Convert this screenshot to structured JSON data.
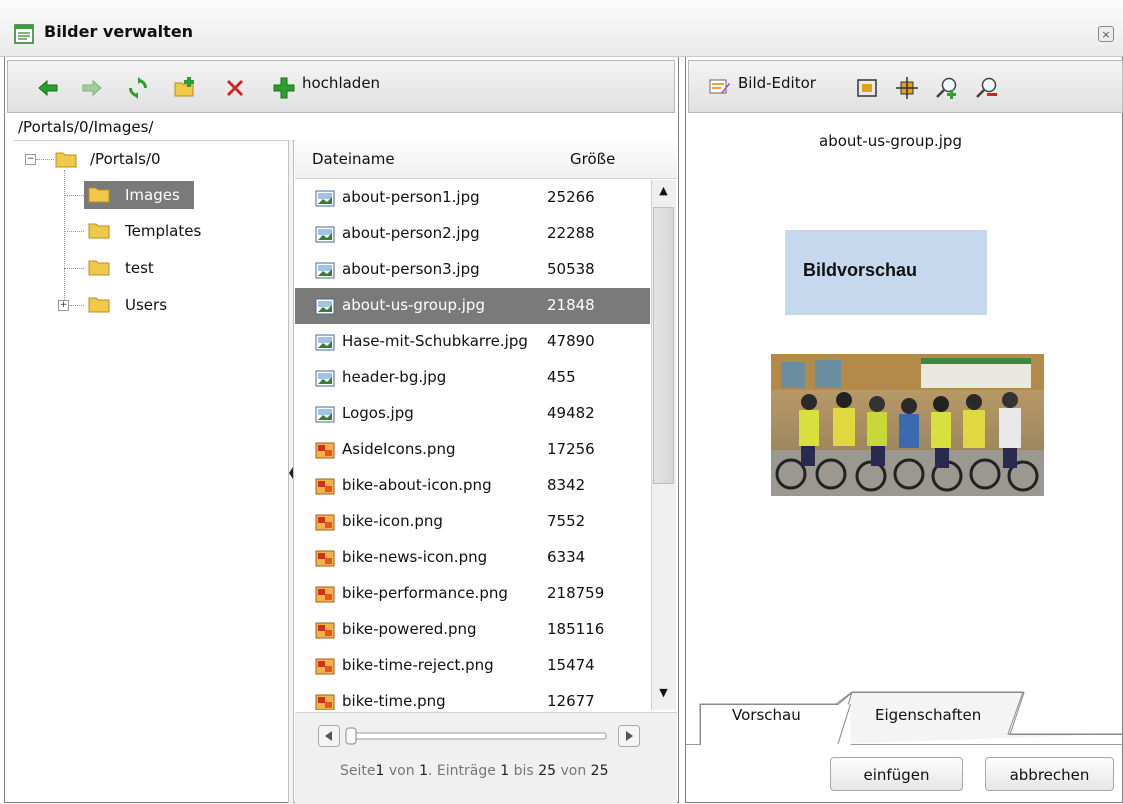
{
  "window": {
    "title": "Bilder verwalten",
    "close_symbol": "×"
  },
  "left_toolbar": {
    "icons": [
      "arrow-left-icon",
      "arrow-right-icon",
      "refresh-icon",
      "new-folder-icon",
      "delete-icon",
      "add-icon"
    ],
    "upload_label": "hochladen"
  },
  "path": "/Portals/0/Images/",
  "tree": {
    "root": {
      "label": "/Portals/0",
      "expander": "−"
    },
    "children": [
      {
        "label": "Images",
        "selected": true
      },
      {
        "label": "Templates"
      },
      {
        "label": "test"
      },
      {
        "label": "Users",
        "expander": "+"
      }
    ]
  },
  "file_list": {
    "columns": {
      "name": "Dateiname",
      "size": "Größe"
    },
    "rows": [
      {
        "name": "about-person1.jpg",
        "size": "25266",
        "type": "jpg"
      },
      {
        "name": "about-person2.jpg",
        "size": "22288",
        "type": "jpg"
      },
      {
        "name": "about-person3.jpg",
        "size": "50538",
        "type": "jpg"
      },
      {
        "name": "about-us-group.jpg",
        "size": "21848",
        "type": "jpg",
        "selected": true
      },
      {
        "name": "Hase-mit-Schubkarre.jpg",
        "size": "47890",
        "type": "jpg"
      },
      {
        "name": "header-bg.jpg",
        "size": "455",
        "type": "jpg"
      },
      {
        "name": "Logos.jpg",
        "size": "49482",
        "type": "jpg"
      },
      {
        "name": "AsideIcons.png",
        "size": "17256",
        "type": "png"
      },
      {
        "name": "bike-about-icon.png",
        "size": "8342",
        "type": "png"
      },
      {
        "name": "bike-icon.png",
        "size": "7552",
        "type": "png"
      },
      {
        "name": "bike-news-icon.png",
        "size": "6334",
        "type": "png"
      },
      {
        "name": "bike-performance.png",
        "size": "218759",
        "type": "png"
      },
      {
        "name": "bike-powered.png",
        "size": "185116",
        "type": "png"
      },
      {
        "name": "bike-time-reject.png",
        "size": "15474",
        "type": "png"
      },
      {
        "name": "bike-time.png",
        "size": "12677",
        "type": "png"
      }
    ]
  },
  "pager": {
    "seite": "Seite",
    "page": "1",
    "von1": "von",
    "pages": "1",
    "eintraege": ". Einträge",
    "from": "1",
    "bis": "bis",
    "to": "25",
    "von2": "von",
    "total": "25"
  },
  "right_toolbar": {
    "editor_label": "Bild-Editor",
    "icons": [
      "fit-icon",
      "center-icon",
      "zoom-in-icon",
      "zoom-out-icon"
    ]
  },
  "preview": {
    "filename": "about-us-group.jpg",
    "placeholder_label": "Bildvorschau"
  },
  "tabs": [
    {
      "label": "Vorschau",
      "active": true
    },
    {
      "label": "Eigenschaften"
    }
  ],
  "buttons": {
    "insert": "einfügen",
    "cancel": "abbrechen"
  },
  "colors": {
    "selection": "#7a7a7a",
    "preview_box": "#c5d8ee",
    "arrow_green": "#2e9e2e",
    "delete_red": "#d42020"
  }
}
